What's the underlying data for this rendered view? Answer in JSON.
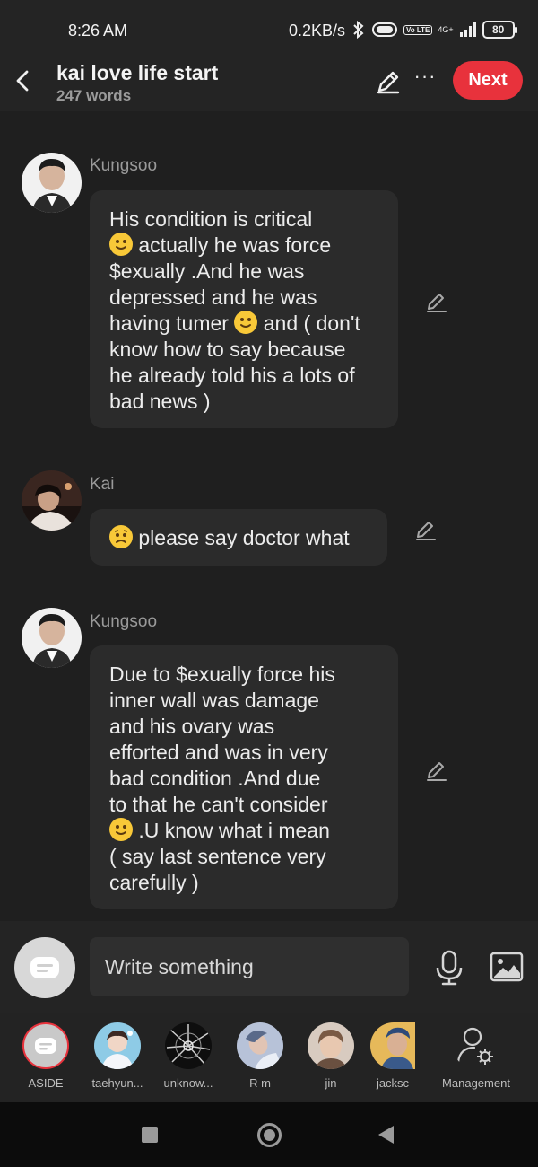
{
  "status_bar": {
    "time": "8:26 AM",
    "speed": "0.2KB/s",
    "network": "4G+",
    "volte": "Vo LTE",
    "battery": "80"
  },
  "header": {
    "title": "kai love life start",
    "subtitle": "247 words",
    "next_label": "Next",
    "more_label": "···"
  },
  "messages": [
    {
      "speaker": "Kungsoo",
      "lines": [
        "His condition is critical",
        " actually he was force",
        "$exually  .And he was",
        "depressed and he was",
        "having tumer ",
        " and ( don't",
        "know how to say because",
        "he already told his a lots of",
        "bad news )"
      ]
    },
    {
      "speaker": "Kai",
      "lines": [
        " please say doctor what"
      ]
    },
    {
      "speaker": "Kungsoo",
      "lines": [
        "Due to $exually force his",
        "inner wall was damage",
        "and his ovary was",
        "efforted and was in very",
        "bad condition .And due",
        "to that he can't consider",
        " .U know what i mean",
        "( say last sentence very",
        "carefully )"
      ]
    }
  ],
  "composer": {
    "placeholder": "Write something"
  },
  "characters": [
    {
      "label": "ASIDE"
    },
    {
      "label": "taehyun..."
    },
    {
      "label": "unknow..."
    },
    {
      "label": "R m"
    },
    {
      "label": "jin"
    },
    {
      "label": "jacksc"
    },
    {
      "label": "Management"
    }
  ],
  "colors": {
    "accent": "#e8323c",
    "background": "#1f1f1f",
    "bubble": "#2b2b2b",
    "emoji": "#f8c838"
  }
}
